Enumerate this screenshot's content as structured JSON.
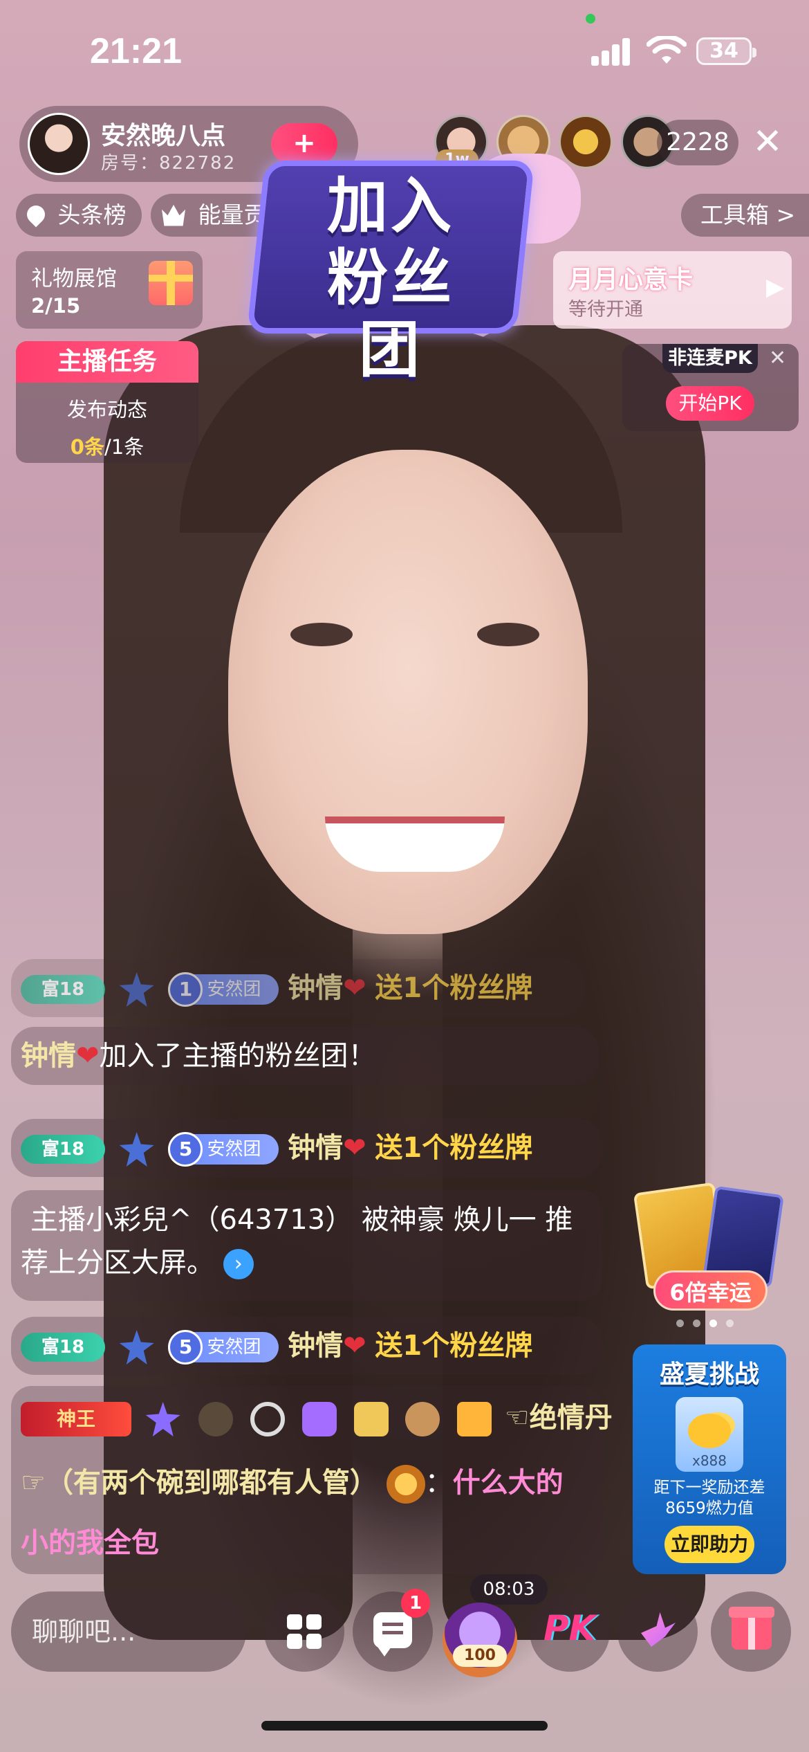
{
  "status_bar": {
    "time": "21:21",
    "battery": "34"
  },
  "host": {
    "name": "安然晚八点",
    "room": "房号：822782",
    "follow_label": "+"
  },
  "viewers": {
    "top_badge": "1w",
    "count": "2228"
  },
  "pills": {
    "headline": "头条榜",
    "energy": "能量贡献",
    "toolbox": "工具箱 >"
  },
  "gift_hall": {
    "title": "礼物展馆",
    "count": "2/15"
  },
  "task": {
    "title": "主播任务",
    "sub": "发布动态",
    "done": "0条",
    "total": "/1条"
  },
  "fan_banner": {
    "text": "加入粉丝团"
  },
  "heart_card": {
    "title": "月月心意卡",
    "sub": "等待开通"
  },
  "pk": {
    "tag": "非连麦PK",
    "close": "✕",
    "start": "开始PK"
  },
  "chat": [
    {
      "rich": "富18",
      "star": "2",
      "fan_lv": "1",
      "fan": "安然团",
      "user": "钟情",
      "gift": "送1个粉丝牌"
    },
    {
      "text1": "钟情",
      "text2": "加入了主播的粉丝团！"
    },
    {
      "rich": "富18",
      "star": "2",
      "fan_lv": "5",
      "fan": "安然团",
      "user": "钟情",
      "gift": "送1个粉丝牌"
    },
    {
      "line1": "主播小彩兒^（643713） 被神豪 焕儿一 推",
      "line2": "荐上分区大屏。"
    },
    {
      "rich": "富18",
      "star": "2",
      "fan_lv": "5",
      "fan": "安然团",
      "user": "钟情",
      "gift": "送1个粉丝牌"
    },
    {
      "king": "神王",
      "user": "☜绝情丹",
      "line2a": "☞（有两个碗到哪都有人管）",
      "line2b": "：",
      "line2c": "什么大的",
      "line3": "小的我全包"
    }
  ],
  "luck": {
    "label": "6倍幸运"
  },
  "summer": {
    "title": "盛夏挑战",
    "qty": "x888",
    "sub1": "距下一奖励还差",
    "sub2": "8659燃力值",
    "button": "立即助力"
  },
  "bottom": {
    "placeholder": "聊聊吧...",
    "notif": "1",
    "timer": "08:03",
    "avatar_level": "100",
    "pk_label": "PK"
  }
}
